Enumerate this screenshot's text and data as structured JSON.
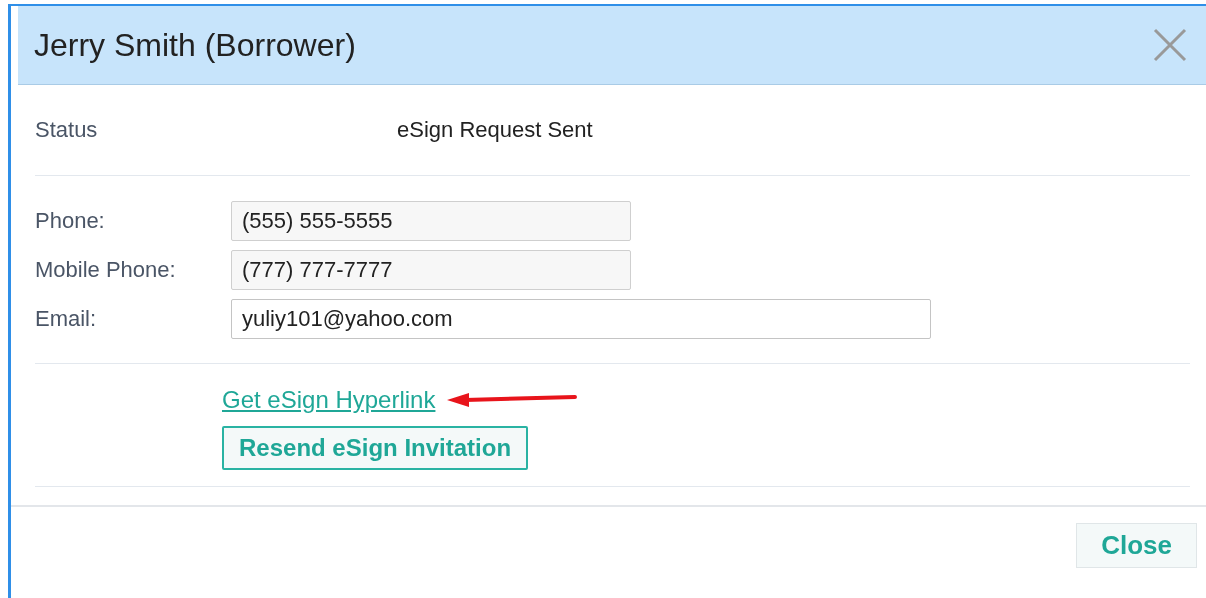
{
  "dialog": {
    "title": "Jerry Smith (Borrower)"
  },
  "status": {
    "label": "Status",
    "value": "eSign Request Sent"
  },
  "fields": [
    {
      "label": "Phone:",
      "value": "(555) 555-5555",
      "disabled": true
    },
    {
      "label": "Mobile Phone:",
      "value": "(777) 777-7777",
      "disabled": true
    },
    {
      "label": "Email:",
      "value": "yuliy101@yahoo.com",
      "disabled": false
    }
  ],
  "actions": [
    {
      "kind": "link",
      "label": "Get eSign Hyperlink"
    },
    {
      "kind": "button",
      "label": "Resend eSign Invitation"
    }
  ],
  "footer": {
    "buttons": [
      "Close"
    ]
  }
}
